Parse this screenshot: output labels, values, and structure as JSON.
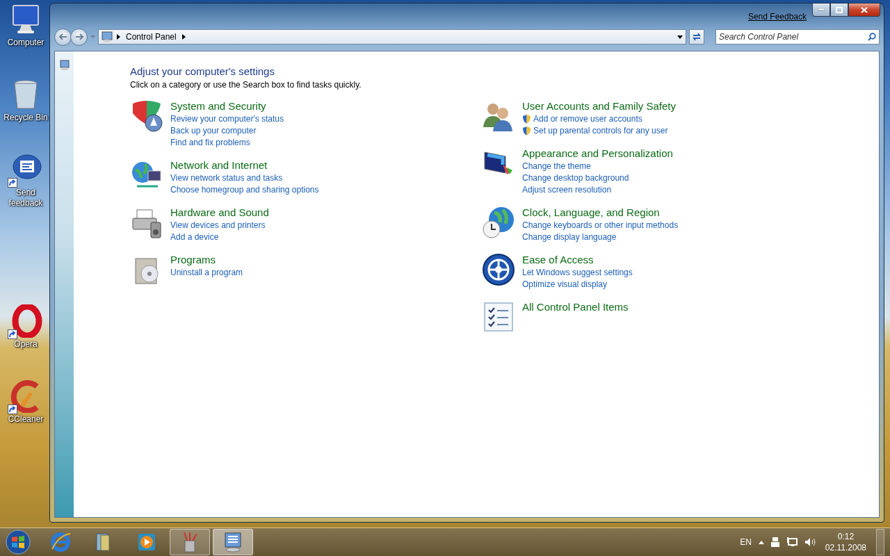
{
  "desktop_icons": [
    {
      "kind": "computer",
      "label": "Computer",
      "shortcut": false
    },
    {
      "kind": "recycle-bin",
      "label": "Recycle Bin",
      "shortcut": false
    },
    {
      "kind": "feedback",
      "label": "Send feedback",
      "shortcut": true
    },
    {
      "kind": "opera",
      "label": "Opera",
      "shortcut": true
    },
    {
      "kind": "ccleaner",
      "label": "CCleaner",
      "shortcut": true
    }
  ],
  "window": {
    "send_feedback": "Send Feedback",
    "address_path": [
      "Control Panel"
    ],
    "search": {
      "placeholder": "Search Control Panel"
    },
    "heading": "Adjust your computer's settings",
    "subheading": "Click on a category or use the Search box to find tasks quickly.",
    "columns": [
      [
        {
          "kind": "security",
          "title": "System and Security",
          "links": [
            {
              "label": "Review your computer's status",
              "shield": false
            },
            {
              "label": "Back up your computer",
              "shield": false
            },
            {
              "label": "Find and fix problems",
              "shield": false
            }
          ]
        },
        {
          "kind": "network",
          "title": "Network and Internet",
          "links": [
            {
              "label": "View network status and tasks",
              "shield": false
            },
            {
              "label": "Choose homegroup and sharing options",
              "shield": false
            }
          ]
        },
        {
          "kind": "hardware",
          "title": "Hardware and Sound",
          "links": [
            {
              "label": "View devices and printers",
              "shield": false
            },
            {
              "label": "Add a device",
              "shield": false
            }
          ]
        },
        {
          "kind": "programs",
          "title": "Programs",
          "links": [
            {
              "label": "Uninstall a program",
              "shield": false
            }
          ]
        }
      ],
      [
        {
          "kind": "users",
          "title": "User Accounts and Family Safety",
          "links": [
            {
              "label": "Add or remove user accounts",
              "shield": true
            },
            {
              "label": "Set up parental controls for any user",
              "shield": true
            }
          ]
        },
        {
          "kind": "appearance",
          "title": "Appearance and Personalization",
          "links": [
            {
              "label": "Change the theme",
              "shield": false
            },
            {
              "label": "Change desktop background",
              "shield": false
            },
            {
              "label": "Adjust screen resolution",
              "shield": false
            }
          ]
        },
        {
          "kind": "clock",
          "title": "Clock, Language, and Region",
          "links": [
            {
              "label": "Change keyboards or other input methods",
              "shield": false
            },
            {
              "label": "Change display language",
              "shield": false
            }
          ]
        },
        {
          "kind": "access",
          "title": "Ease of Access",
          "links": [
            {
              "label": "Let Windows suggest settings",
              "shield": false
            },
            {
              "label": "Optimize visual display",
              "shield": false
            }
          ]
        },
        {
          "kind": "all-items",
          "title": "All Control Panel Items"
        }
      ]
    ]
  },
  "taskbar": {
    "items": [
      {
        "kind": "ie",
        "running": false,
        "selected": false
      },
      {
        "kind": "explorer",
        "running": false,
        "selected": false
      },
      {
        "kind": "media",
        "running": false,
        "selected": false
      },
      {
        "kind": "paint",
        "running": true,
        "selected": false
      },
      {
        "kind": "control-panel",
        "running": true,
        "selected": true
      }
    ],
    "language": "EN",
    "time": "0:12",
    "date": "02.11.2008"
  }
}
